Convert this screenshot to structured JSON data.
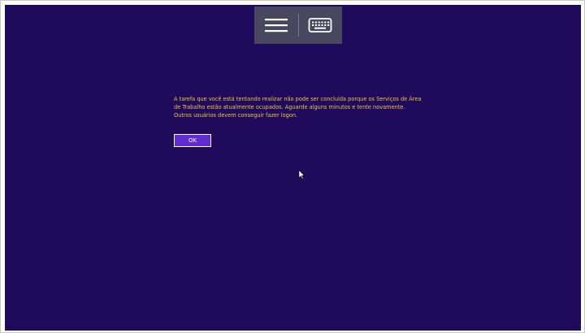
{
  "dialog": {
    "message_lines": [
      "A tarefa que você está tentando realizar não pode ser concluída porque os Serviços de Área",
      "de Trabalho estão atualmente ocupados. Aguarde alguns minutos e tente novamente.",
      "Outros usuários devem conseguir fazer logon."
    ],
    "ok_label": "OK"
  },
  "toolbar": {
    "menu_icon": "hamburger-menu-icon",
    "keyboard_icon": "keyboard-icon"
  },
  "colors": {
    "background": "#1f0a5c",
    "message_text": "#f0c24a",
    "button_fill": "#5f2dd1",
    "toolbar_bg": "#494760"
  }
}
